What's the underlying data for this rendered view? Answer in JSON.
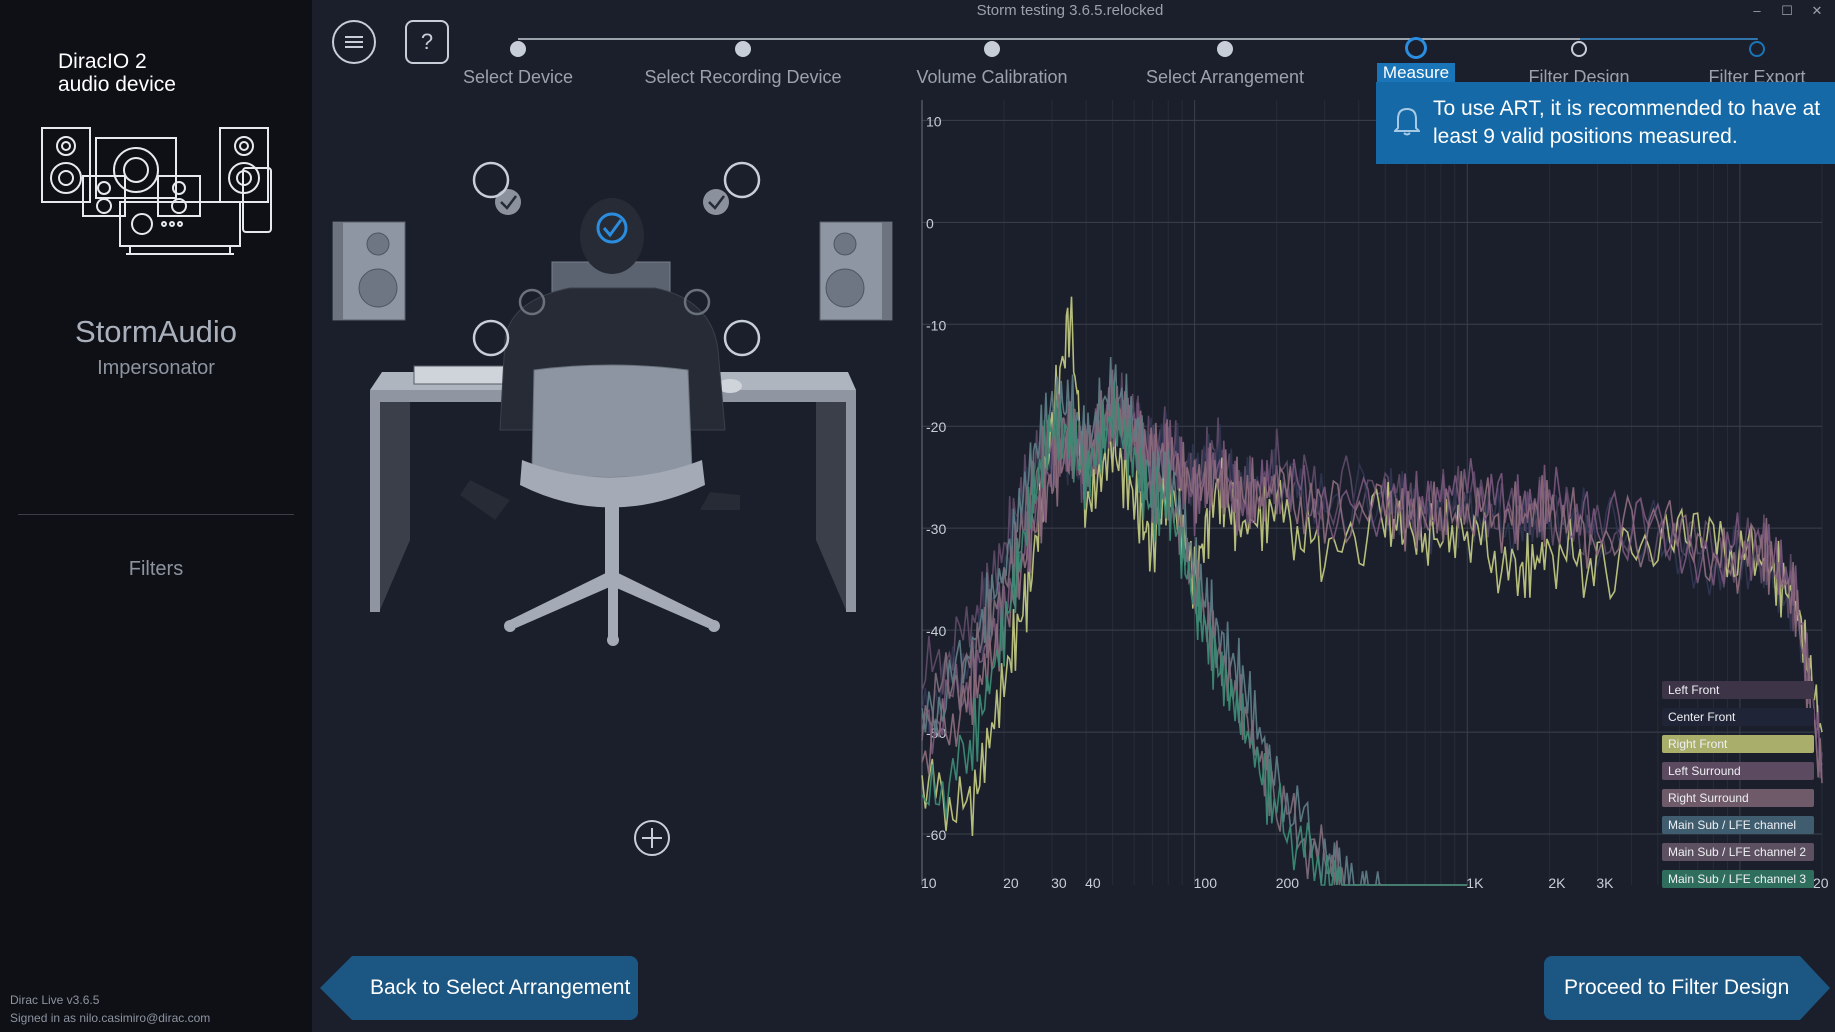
{
  "window": {
    "title": "Storm testing 3.6.5.relocked",
    "minimize_glyph": "–",
    "maximize_glyph": "☐",
    "close_glyph": "✕"
  },
  "sidebar": {
    "brand_line1": "DiracIO 2",
    "brand_line2": "audio device",
    "device_name": "StormAudio",
    "device_model": "Impersonator",
    "filters_label": "Filters",
    "version": "Dirac Live v3.6.5",
    "signed_in": "Signed in as nilo.casimiro@dirac.com"
  },
  "toolbar": {
    "menu_icon": "hamburger-icon",
    "help_label": "?"
  },
  "steps": [
    {
      "label": "Select Device",
      "state": "done"
    },
    {
      "label": "Select Recording Device",
      "state": "done"
    },
    {
      "label": "Volume Calibration",
      "state": "done"
    },
    {
      "label": "Select Arrangement",
      "state": "done"
    },
    {
      "label": "Measure",
      "state": "current"
    },
    {
      "label": "Filter Design",
      "state": "pending"
    },
    {
      "label": "Filter Export",
      "state": "pending"
    }
  ],
  "notification": {
    "icon": "bell-icon",
    "line1": "To use ART, it is recommended to have at",
    "line2": "least 9 valid positions measured."
  },
  "measurement_positions": [
    {
      "id": 1,
      "status": "measured-current"
    },
    {
      "id": 2,
      "status": "measured"
    },
    {
      "id": 3,
      "status": "measured"
    },
    {
      "id": 4,
      "status": "empty"
    },
    {
      "id": 5,
      "status": "empty"
    },
    {
      "id": 6,
      "status": "empty"
    },
    {
      "id": 7,
      "status": "empty"
    },
    {
      "id": 8,
      "status": "empty"
    },
    {
      "id": 9,
      "status": "empty"
    }
  ],
  "add_position_icon": "plus-circle-icon",
  "chart_data": {
    "type": "line",
    "xscale": "log",
    "xlim": [
      10,
      20000
    ],
    "ylim": [
      -65,
      12
    ],
    "y_ticks": [
      {
        "value": 10,
        "label": "10"
      },
      {
        "value": 0,
        "label": "0"
      },
      {
        "value": -10,
        "label": "-10"
      },
      {
        "value": -20,
        "label": "-20"
      },
      {
        "value": -30,
        "label": "-30"
      },
      {
        "value": -40,
        "label": "-40"
      },
      {
        "value": -50,
        "label": "-50"
      },
      {
        "value": -60,
        "label": "-60"
      }
    ],
    "x_ticks": [
      {
        "value": 10,
        "label": "10"
      },
      {
        "value": 20,
        "label": "20"
      },
      {
        "value": 30,
        "label": "30"
      },
      {
        "value": 40,
        "label": "40"
      },
      {
        "value": 100,
        "label": "100"
      },
      {
        "value": 200,
        "label": "200"
      },
      {
        "value": 1000,
        "label": "1K"
      },
      {
        "value": 2000,
        "label": "2K"
      },
      {
        "value": 3000,
        "label": "3K"
      },
      {
        "value": 20000,
        "label": "20"
      }
    ],
    "grid": true,
    "legend": "bottom-right",
    "series": [
      {
        "name": "Left Front",
        "color": "#5e4a66",
        "x": [
          10,
          15,
          20,
          25,
          30,
          35,
          40,
          50,
          60,
          70,
          80,
          100,
          120,
          150,
          200,
          300,
          500,
          700,
          1000,
          1500,
          2000,
          3000,
          5000,
          8000,
          12000,
          16000,
          20000
        ],
        "y": [
          -45,
          -40,
          -32,
          -24,
          -22,
          -21,
          -25,
          -18,
          -19,
          -23,
          -21,
          -26,
          -22,
          -27,
          -24,
          -27,
          -26,
          -28,
          -27,
          -29,
          -28,
          -31,
          -30,
          -33,
          -32,
          -37,
          -52
        ]
      },
      {
        "name": "Center Front",
        "color": "#2f3550",
        "x": [
          10,
          15,
          20,
          25,
          30,
          35,
          40,
          50,
          60,
          70,
          80,
          100,
          120,
          150,
          200,
          300,
          500,
          700,
          1000,
          1500,
          2000,
          3000,
          5000,
          8000,
          12000,
          16000,
          20000
        ],
        "y": [
          -48,
          -42,
          -34,
          -26,
          -23,
          -22,
          -24,
          -20,
          -21,
          -22,
          -22,
          -25,
          -23,
          -26,
          -25,
          -28,
          -27,
          -29,
          -28,
          -30,
          -29,
          -30,
          -31,
          -33,
          -33,
          -38,
          -54
        ]
      },
      {
        "name": "Right Front",
        "color": "#bfc57e",
        "x": [
          10,
          15,
          20,
          25,
          30,
          35,
          40,
          50,
          60,
          70,
          80,
          100,
          120,
          150,
          200,
          300,
          500,
          700,
          1000,
          1500,
          2000,
          3000,
          5000,
          8000,
          12000,
          16000,
          20000
        ],
        "y": [
          -55,
          -58,
          -45,
          -35,
          -20,
          -9,
          -28,
          -22,
          -27,
          -32,
          -25,
          -35,
          -26,
          -30,
          -28,
          -33,
          -29,
          -31,
          -30,
          -35,
          -32,
          -34,
          -31,
          -32,
          -33,
          -37,
          -50
        ]
      },
      {
        "name": "Left Surround",
        "color": "#76547a",
        "x": [
          10,
          15,
          20,
          25,
          30,
          35,
          40,
          50,
          60,
          70,
          80,
          100,
          120,
          150,
          200,
          300,
          500,
          700,
          1000,
          1500,
          2000,
          3000,
          5000,
          8000,
          12000,
          16000,
          20000
        ],
        "y": [
          -50,
          -45,
          -38,
          -30,
          -24,
          -21,
          -23,
          -19,
          -20,
          -24,
          -22,
          -27,
          -24,
          -28,
          -25,
          -28,
          -27,
          -28,
          -26,
          -28,
          -27,
          -30,
          -29,
          -33,
          -31,
          -36,
          -53
        ]
      },
      {
        "name": "Right Surround",
        "color": "#8a6a7a",
        "x": [
          10,
          15,
          20,
          25,
          30,
          35,
          40,
          50,
          60,
          70,
          80,
          100,
          120,
          150,
          200,
          300,
          500,
          700,
          1000,
          1500,
          2000,
          3000,
          5000,
          8000,
          12000,
          16000,
          20000
        ],
        "y": [
          -52,
          -47,
          -40,
          -31,
          -25,
          -22,
          -24,
          -18,
          -21,
          -23,
          -23,
          -26,
          -25,
          -27,
          -26,
          -29,
          -28,
          -29,
          -28,
          -29,
          -28,
          -31,
          -30,
          -34,
          -32,
          -37,
          -55
        ]
      },
      {
        "name": "Main Sub / LFE channel",
        "color": "#5e7c86",
        "x": [
          10,
          15,
          20,
          25,
          30,
          35,
          40,
          50,
          60,
          70,
          80,
          100,
          120,
          150,
          200,
          300,
          400,
          500,
          700,
          1000
        ],
        "y": [
          -50,
          -42,
          -34,
          -24,
          -18,
          -18,
          -22,
          -16,
          -20,
          -26,
          -24,
          -34,
          -40,
          -45,
          -55,
          -62,
          -66,
          -68,
          -70,
          -72
        ]
      },
      {
        "name": "Main Sub / LFE channel 2",
        "color": "#7c6a78",
        "x": [
          10,
          15,
          20,
          25,
          30,
          35,
          40,
          50,
          60,
          70,
          80,
          100,
          120,
          150,
          200,
          300,
          400,
          500,
          700,
          1000
        ],
        "y": [
          -48,
          -43,
          -36,
          -27,
          -21,
          -20,
          -23,
          -18,
          -22,
          -27,
          -26,
          -36,
          -42,
          -48,
          -57,
          -63,
          -67,
          -69,
          -71,
          -73
        ]
      },
      {
        "name": "Main Sub / LFE channel 3",
        "color": "#3c8a74",
        "x": [
          10,
          15,
          20,
          25,
          30,
          35,
          40,
          50,
          60,
          70,
          80,
          100,
          120,
          150,
          200,
          300,
          400,
          500,
          700,
          1000
        ],
        "y": [
          -58,
          -52,
          -40,
          -28,
          -20,
          -21,
          -25,
          -19,
          -23,
          -28,
          -27,
          -37,
          -43,
          -49,
          -58,
          -64,
          -68,
          -70,
          -72,
          -74
        ]
      }
    ]
  },
  "legend_colors": [
    "#3e3448",
    "#1f2436",
    "#a9ae6b",
    "#5c4a60",
    "#6e5a68",
    "#3f5d6f",
    "#5d5061",
    "#2f6e5d"
  ],
  "nav": {
    "back_label": "Back to Select Arrangement",
    "next_label": "Proceed to Filter Design"
  }
}
